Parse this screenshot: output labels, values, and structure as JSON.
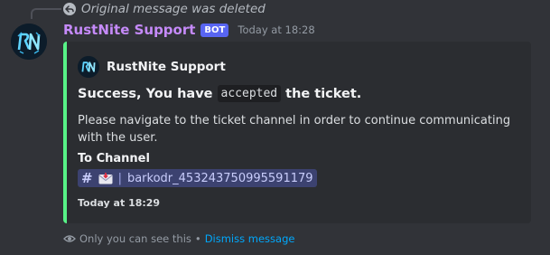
{
  "reply": {
    "text": "Original message was deleted",
    "icon": "reply-deleted-icon"
  },
  "message": {
    "username": "RustNite Support",
    "bot_tag": "BOT",
    "timestamp": "Today at 18:28",
    "avatar_logo": "RN",
    "username_color": "#c58af9"
  },
  "embed": {
    "accent_color": "#57f287",
    "author_name": "RustNite Support",
    "title_before": "Success, You have",
    "title_code": "accepted",
    "title_after": "the ticket.",
    "description": "Please navigate to the ticket channel in order to continue communicating with the user.",
    "field_name": "To Channel",
    "channel_hash": "#",
    "channel_separator": "|",
    "channel_name": "barkodr_453243750995591179",
    "footer": "Today at 18:29"
  },
  "ephemeral": {
    "text": "Only you can see this",
    "separator": "•",
    "dismiss_label": "Dismiss message"
  }
}
